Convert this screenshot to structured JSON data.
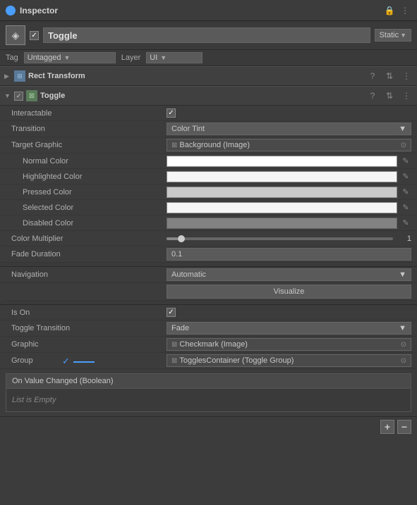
{
  "titleBar": {
    "label": "Inspector",
    "lockIcon": "🔒",
    "menuIcon": "⋮"
  },
  "objectHeader": {
    "name": "Toggle",
    "staticLabel": "Static",
    "tagLabel": "Tag",
    "tagValue": "Untagged",
    "layerLabel": "Layer",
    "layerValue": "UI"
  },
  "rectTransform": {
    "title": "Rect Transform"
  },
  "toggle": {
    "title": "Toggle",
    "fields": {
      "interactableLabel": "Interactable",
      "transitionLabel": "Transition",
      "transitionValue": "Color Tint",
      "targetGraphicLabel": "Target Graphic",
      "targetGraphicValue": "Background (Image)",
      "normalColorLabel": "Normal Color",
      "highlightedColorLabel": "Highlighted Color",
      "pressedColorLabel": "Pressed Color",
      "selectedColorLabel": "Selected Color",
      "disabledColorLabel": "Disabled Color",
      "colorMultiplierLabel": "Color Multiplier",
      "colorMultiplierValue": "1",
      "fadeDurationLabel": "Fade Duration",
      "fadeDurationValue": "0.1",
      "navigationLabel": "Navigation",
      "navigationValue": "Automatic",
      "visualizeLabel": "Visualize",
      "isOnLabel": "Is On",
      "toggleTransitionLabel": "Toggle Transition",
      "toggleTransitionValue": "Fade",
      "graphicLabel": "Graphic",
      "graphicValue": "Checkmark (Image)",
      "groupLabel": "Group",
      "groupValue": "TogglesContainer (Toggle Group)",
      "eventLabel": "On Value Changed (Boolean)",
      "eventEmpty": "List is Empty"
    }
  }
}
